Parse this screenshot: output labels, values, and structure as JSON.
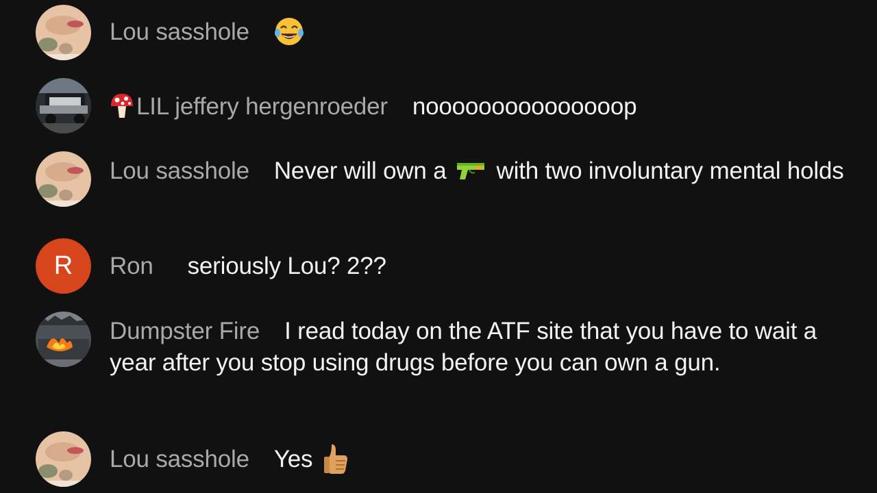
{
  "messages": [
    {
      "author": "Lou sasshole",
      "text": "",
      "avatar": "lou-avatar",
      "trailing_emoji": "laughing-tears-emoji"
    },
    {
      "author": "LIL jeffery hergenroeder",
      "author_prefix_emoji": "mushroom-emoji",
      "text": "nooooooooooooooop",
      "avatar": "truck-photo-avatar"
    },
    {
      "author": "Lou sasshole",
      "text_before": "Never will own a",
      "inline_emoji": "water-pistol-emoji",
      "text_after": "with two involuntary mental holds",
      "avatar": "lou-avatar"
    },
    {
      "author": "Ron",
      "text": "seriously Lou? 2??",
      "avatar_letter": "R",
      "avatar_color": "#d6451b"
    },
    {
      "author": "Dumpster Fire",
      "text": "I read today on the ATF site that you have to wait a year after you stop using drugs before you can own a gun.",
      "avatar": "fire-photo-avatar"
    },
    {
      "author": "Lou sasshole",
      "text": "Yes",
      "avatar": "lou-avatar",
      "trailing_emoji": "thumbs-up-emoji"
    }
  ]
}
